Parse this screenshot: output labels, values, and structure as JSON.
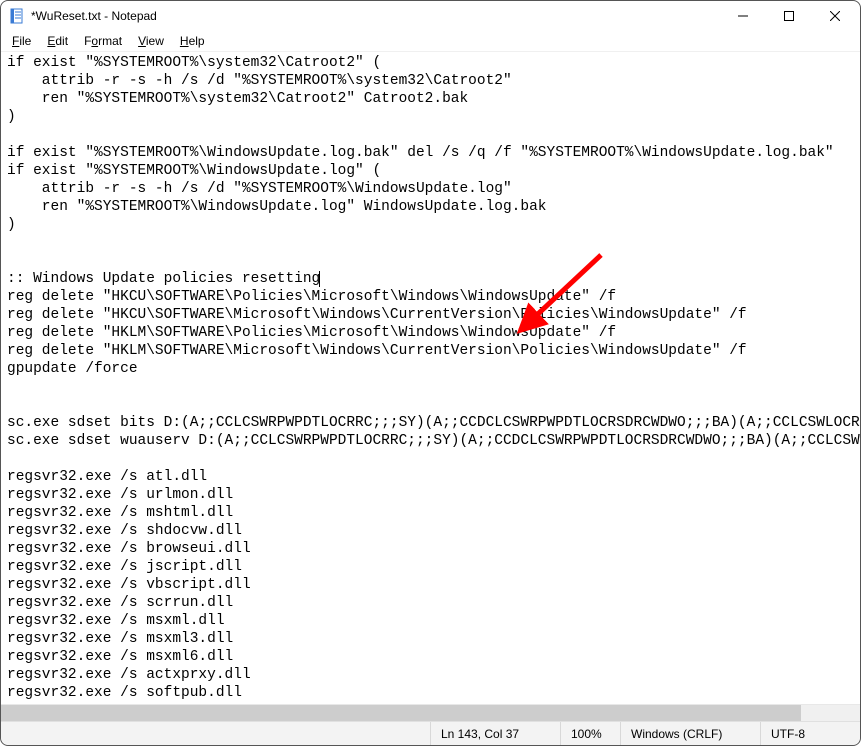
{
  "window": {
    "title": "*WuReset.txt - Notepad"
  },
  "menu": {
    "file": "File",
    "edit": "Edit",
    "format": "Format",
    "view": "View",
    "help": "Help"
  },
  "content": {
    "lines": [
      "if exist \"%SYSTEMROOT%\\system32\\Catroot2\" (",
      "    attrib -r -s -h /s /d \"%SYSTEMROOT%\\system32\\Catroot2\"",
      "    ren \"%SYSTEMROOT%\\system32\\Catroot2\" Catroot2.bak",
      ")",
      "",
      "if exist \"%SYSTEMROOT%\\WindowsUpdate.log.bak\" del /s /q /f \"%SYSTEMROOT%\\WindowsUpdate.log.bak\"",
      "if exist \"%SYSTEMROOT%\\WindowsUpdate.log\" (",
      "    attrib -r -s -h /s /d \"%SYSTEMROOT%\\WindowsUpdate.log\"",
      "    ren \"%SYSTEMROOT%\\WindowsUpdate.log\" WindowsUpdate.log.bak",
      ")",
      "",
      "",
      ":: Windows Update policies resetting",
      "reg delete \"HKCU\\SOFTWARE\\Policies\\Microsoft\\Windows\\WindowsUpdate\" /f",
      "reg delete \"HKCU\\SOFTWARE\\Microsoft\\Windows\\CurrentVersion\\Policies\\WindowsUpdate\" /f",
      "reg delete \"HKLM\\SOFTWARE\\Policies\\Microsoft\\Windows\\WindowsUpdate\" /f",
      "reg delete \"HKLM\\SOFTWARE\\Microsoft\\Windows\\CurrentVersion\\Policies\\WindowsUpdate\" /f",
      "gpupdate /force",
      "",
      "",
      "sc.exe sdset bits D:(A;;CCLCSWRPWPDTLOCRRC;;;SY)(A;;CCDCLCSWRPWPDTLOCRSDRCWDWO;;;BA)(A;;CCLCSWLOCRRC;;;AU",
      "sc.exe sdset wuauserv D:(A;;CCLCSWRPWPDTLOCRRC;;;SY)(A;;CCDCLCSWRPWPDTLOCRSDRCWDWO;;;BA)(A;;CCLCSWLOCRRC",
      "",
      "regsvr32.exe /s atl.dll",
      "regsvr32.exe /s urlmon.dll",
      "regsvr32.exe /s mshtml.dll",
      "regsvr32.exe /s shdocvw.dll",
      "regsvr32.exe /s browseui.dll",
      "regsvr32.exe /s jscript.dll",
      "regsvr32.exe /s vbscript.dll",
      "regsvr32.exe /s scrrun.dll",
      "regsvr32.exe /s msxml.dll",
      "regsvr32.exe /s msxml3.dll",
      "regsvr32.exe /s msxml6.dll",
      "regsvr32.exe /s actxprxy.dll",
      "regsvr32.exe /s softpub.dll"
    ],
    "caret_line_index": 12
  },
  "status": {
    "position": "Ln 143, Col 37",
    "zoom": "100%",
    "line_ending": "Windows (CRLF)",
    "encoding": "UTF-8"
  },
  "annotation": {
    "arrow_color": "#ff0000"
  }
}
